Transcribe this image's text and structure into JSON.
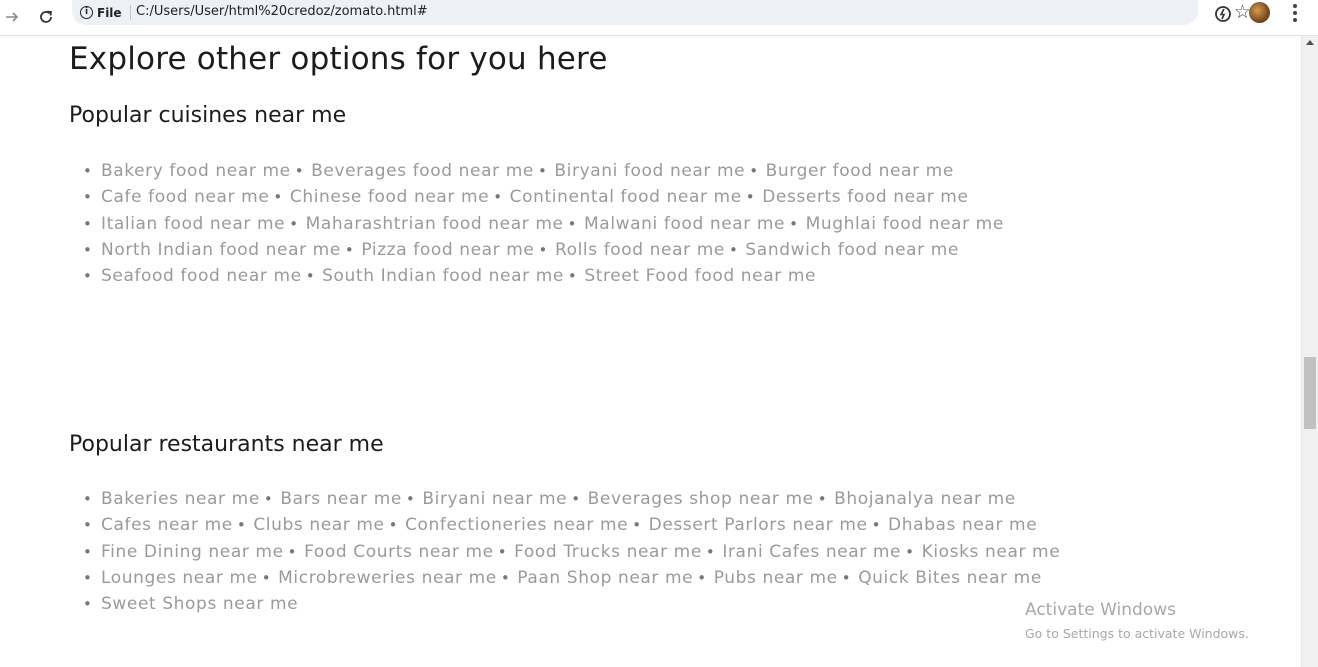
{
  "browser": {
    "site_chip": "File",
    "info_glyph": "i",
    "url": "C:/Users/User/html%20credoz/zomato.html#"
  },
  "page": {
    "title": "Explore other options for you here",
    "cuisines": {
      "heading": "Popular cuisines near me",
      "rows": [
        [
          "Bakery food near me",
          "Beverages food near me",
          "Biryani food near me",
          "Burger food near me"
        ],
        [
          "Cafe food near me",
          "Chinese food near me",
          "Continental food near me",
          "Desserts food near me"
        ],
        [
          "Italian food near me",
          "Maharashtrian food near me",
          "Malwani food near me",
          "Mughlai food near me"
        ],
        [
          "North Indian food near me",
          "Pizza food near me",
          "Rolls food near me",
          "Sandwich food near me"
        ],
        [
          "Seafood food near me",
          "South Indian food near me",
          "Street Food food near me"
        ]
      ]
    },
    "restaurants": {
      "heading": "Popular restaurants near me",
      "rows": [
        [
          "Bakeries near me",
          "Bars near me",
          "Biryani near me",
          "Beverages shop near me",
          "Bhojanalya near me"
        ],
        [
          "Cafes near me",
          "Clubs near me",
          "Confectioneries near me",
          "Dessert Parlors near me",
          "Dhabas near me"
        ],
        [
          "Fine Dining near me",
          "Food Courts near me",
          "Food Trucks near me",
          "Irani Cafes near me",
          "Kiosks near me"
        ],
        [
          "Lounges near me",
          "Microbreweries near me",
          "Paan Shop near me",
          "Pubs near me",
          "Quick Bites near me"
        ],
        [
          "Sweet Shops near me"
        ]
      ]
    }
  },
  "watermark": {
    "title": "Activate Windows",
    "subtitle": "Go to Settings to activate Windows."
  },
  "icons": [
    "forward-icon",
    "reload-icon",
    "info-icon",
    "bookmark-star-icon",
    "extension-icon",
    "profile-avatar",
    "menu-icon"
  ],
  "colors": {
    "link_text": "#9a9a9a",
    "heading_text": "#1c1c1c",
    "omnibox_bg": "#edf0f5"
  }
}
